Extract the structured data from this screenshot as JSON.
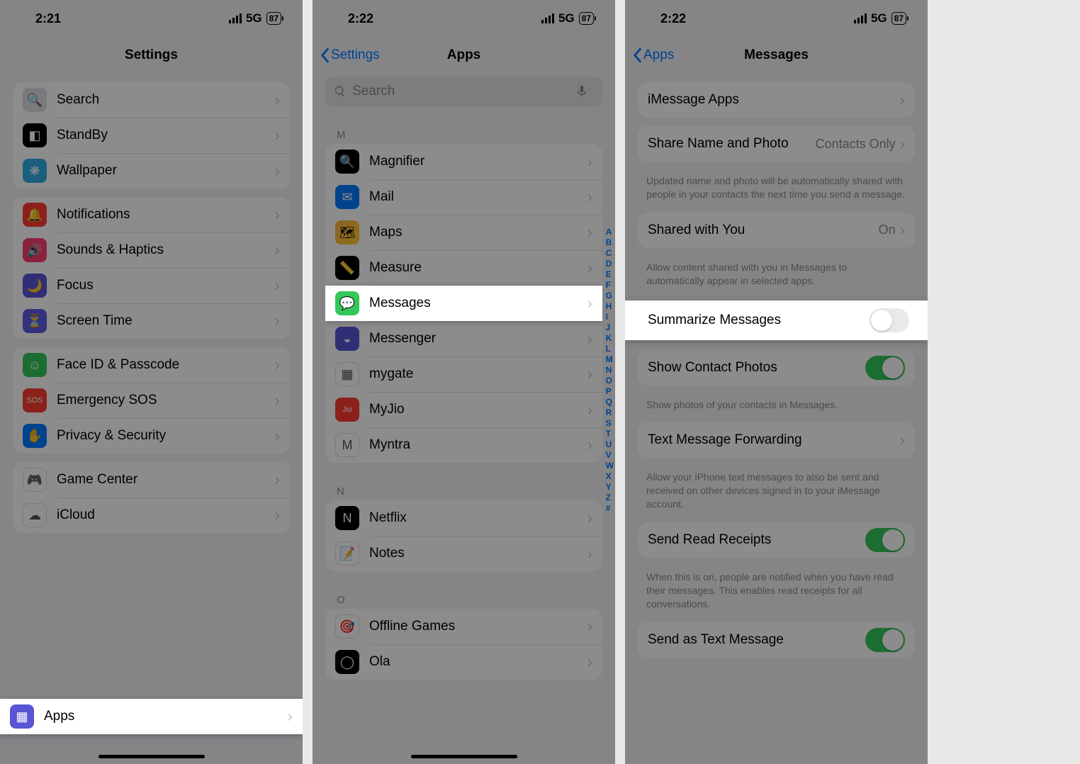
{
  "screen1": {
    "time": "2:21",
    "net": "5G",
    "batt": "87",
    "title": "Settings",
    "g1": [
      {
        "icon": "🔍",
        "cls": "ic-grey",
        "label": "Search"
      },
      {
        "icon": "◧",
        "cls": "ic-black",
        "label": "StandBy"
      },
      {
        "icon": "❋",
        "cls": "ic-cyan",
        "label": "Wallpaper"
      }
    ],
    "g2": [
      {
        "icon": "🔔",
        "cls": "ic-red",
        "label": "Notifications"
      },
      {
        "icon": "🔊",
        "cls": "ic-pink",
        "label": "Sounds & Haptics"
      },
      {
        "icon": "🌙",
        "cls": "ic-purple",
        "label": "Focus"
      },
      {
        "icon": "⏳",
        "cls": "ic-indigo",
        "label": "Screen Time"
      }
    ],
    "g3": [
      {
        "icon": "☺",
        "cls": "ic-green",
        "label": "Face ID & Passcode"
      },
      {
        "icon": "SOS",
        "cls": "ic-red",
        "label": "Emergency SOS"
      },
      {
        "icon": "✋",
        "cls": "ic-blue",
        "label": "Privacy & Security"
      }
    ],
    "g4": [
      {
        "icon": "🎮",
        "cls": "ic-white",
        "label": "Game Center"
      },
      {
        "icon": "☁",
        "cls": "ic-white",
        "label": "iCloud"
      }
    ],
    "g5": [
      {
        "icon": "▦",
        "cls": "ic-purple",
        "label": "Apps"
      }
    ]
  },
  "screen2": {
    "time": "2:22",
    "net": "5G",
    "batt": "87",
    "back": "Settings",
    "title": "Apps",
    "search_placeholder": "Search",
    "secM": "M",
    "listM": [
      {
        "icon": "🔍",
        "cls": "ic-black",
        "label": "Magnifier"
      },
      {
        "icon": "✉",
        "cls": "ic-blue",
        "label": "Mail"
      },
      {
        "icon": "🗺",
        "cls": "ic-img",
        "label": "Maps"
      },
      {
        "icon": "📏",
        "cls": "ic-black",
        "label": "Measure"
      },
      {
        "icon": "💬",
        "cls": "ic-green",
        "label": "Messages",
        "hl": true
      },
      {
        "icon": "◒",
        "cls": "ic-purple",
        "label": "Messenger"
      },
      {
        "icon": "▦",
        "cls": "ic-white",
        "label": "mygate"
      },
      {
        "icon": "Jio",
        "cls": "ic-red",
        "label": "MyJio"
      },
      {
        "icon": "M",
        "cls": "ic-white",
        "label": "Myntra"
      }
    ],
    "secN": "N",
    "listN": [
      {
        "icon": "N",
        "cls": "ic-black",
        "label": "Netflix"
      },
      {
        "icon": "📝",
        "cls": "ic-white",
        "label": "Notes"
      }
    ],
    "secO": "O",
    "listO": [
      {
        "icon": "🎯",
        "cls": "ic-white",
        "label": "Offline Games"
      },
      {
        "icon": "◯",
        "cls": "ic-black",
        "label": "Ola"
      }
    ],
    "index": [
      "A",
      "B",
      "C",
      "D",
      "E",
      "F",
      "G",
      "H",
      "I",
      "J",
      "K",
      "L",
      "M",
      "N",
      "O",
      "P",
      "Q",
      "R",
      "S",
      "T",
      "U",
      "V",
      "W",
      "X",
      "Y",
      "Z",
      "#"
    ]
  },
  "screen3": {
    "time": "2:22",
    "net": "5G",
    "batt": "87",
    "back": "Apps",
    "title": "Messages",
    "rows": {
      "imessage_apps": "iMessage Apps",
      "share_name": "Share Name and Photo",
      "share_name_val": "Contacts Only",
      "share_name_foot": "Updated name and photo will be automatically shared with people in your contacts the next time you send a message.",
      "shared_with_you": "Shared with You",
      "shared_with_you_val": "On",
      "shared_foot": "Allow content shared with you in Messages to automatically appear in selected apps.",
      "summarize": "Summarize Messages",
      "show_photos": "Show Contact Photos",
      "show_photos_foot": "Show photos of your contacts in Messages.",
      "forward": "Text Message Forwarding",
      "forward_foot": "Allow your iPhone text messages to also be sent and received on other devices signed in to your iMessage account.",
      "read": "Send Read Receipts",
      "read_foot": "When this is on, people are notified when you have read their messages. This enables read receipts for all conversations.",
      "sendtxt": "Send as Text Message"
    }
  }
}
